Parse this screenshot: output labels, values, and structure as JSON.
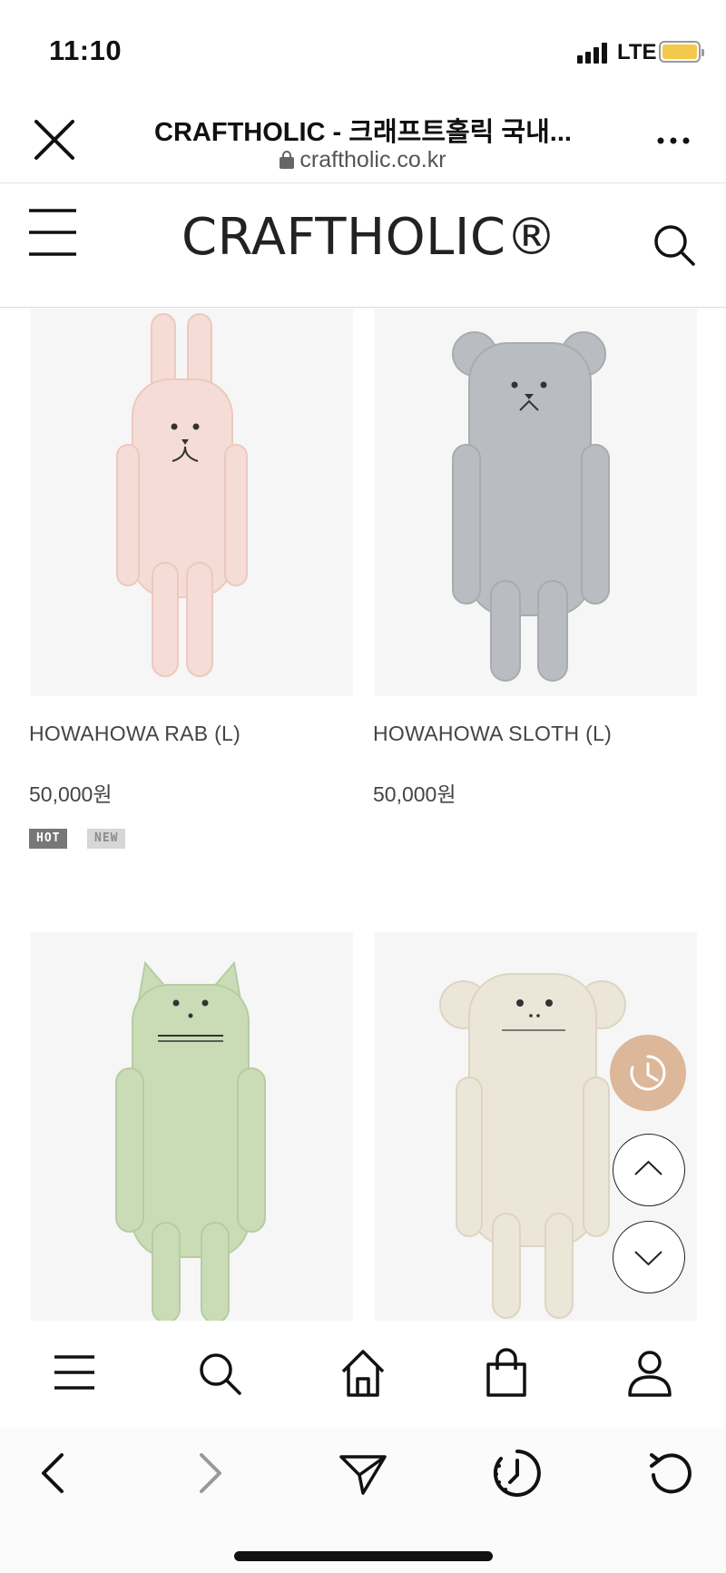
{
  "status_bar": {
    "time": "11:10",
    "network": "LTE"
  },
  "browser": {
    "title": "CRAFTHOLIC - 크래프트홀릭 국내...",
    "url": "craftholic.co.kr",
    "more_label": "..."
  },
  "site": {
    "logo": "CRAFTHOLIC®"
  },
  "products": [
    {
      "name": "HOWAHOWA RAB (L)",
      "price": "50,000원",
      "badges": [
        "HOT",
        "NEW"
      ]
    },
    {
      "name": "HOWAHOWA SLOTH (L)",
      "price": "50,000원",
      "badges": []
    },
    {
      "name": "",
      "price": "",
      "badges": []
    },
    {
      "name": "",
      "price": "",
      "badges": []
    }
  ],
  "colors": {
    "recent_button": "#dcb79a",
    "rab_pink": "#f6dcd6",
    "sloth_gray": "#b9bcc0",
    "cat_green": "#c9dcb6",
    "monkey_cream": "#ece6d8",
    "battery": "#f2c94c"
  },
  "icons": {
    "close": "close-icon",
    "lock": "lock-icon",
    "more": "more-icon",
    "menu": "hamburger-icon",
    "search": "search-icon",
    "home": "home-icon",
    "cart": "shopping-bag-icon",
    "account": "user-icon",
    "back": "chevron-left-icon",
    "forward": "chevron-right-icon",
    "share": "send-icon",
    "history": "history-icon",
    "reload": "reload-icon",
    "recent": "clock-icon",
    "scroll_up": "chevron-up-icon",
    "scroll_down": "chevron-down-icon"
  }
}
